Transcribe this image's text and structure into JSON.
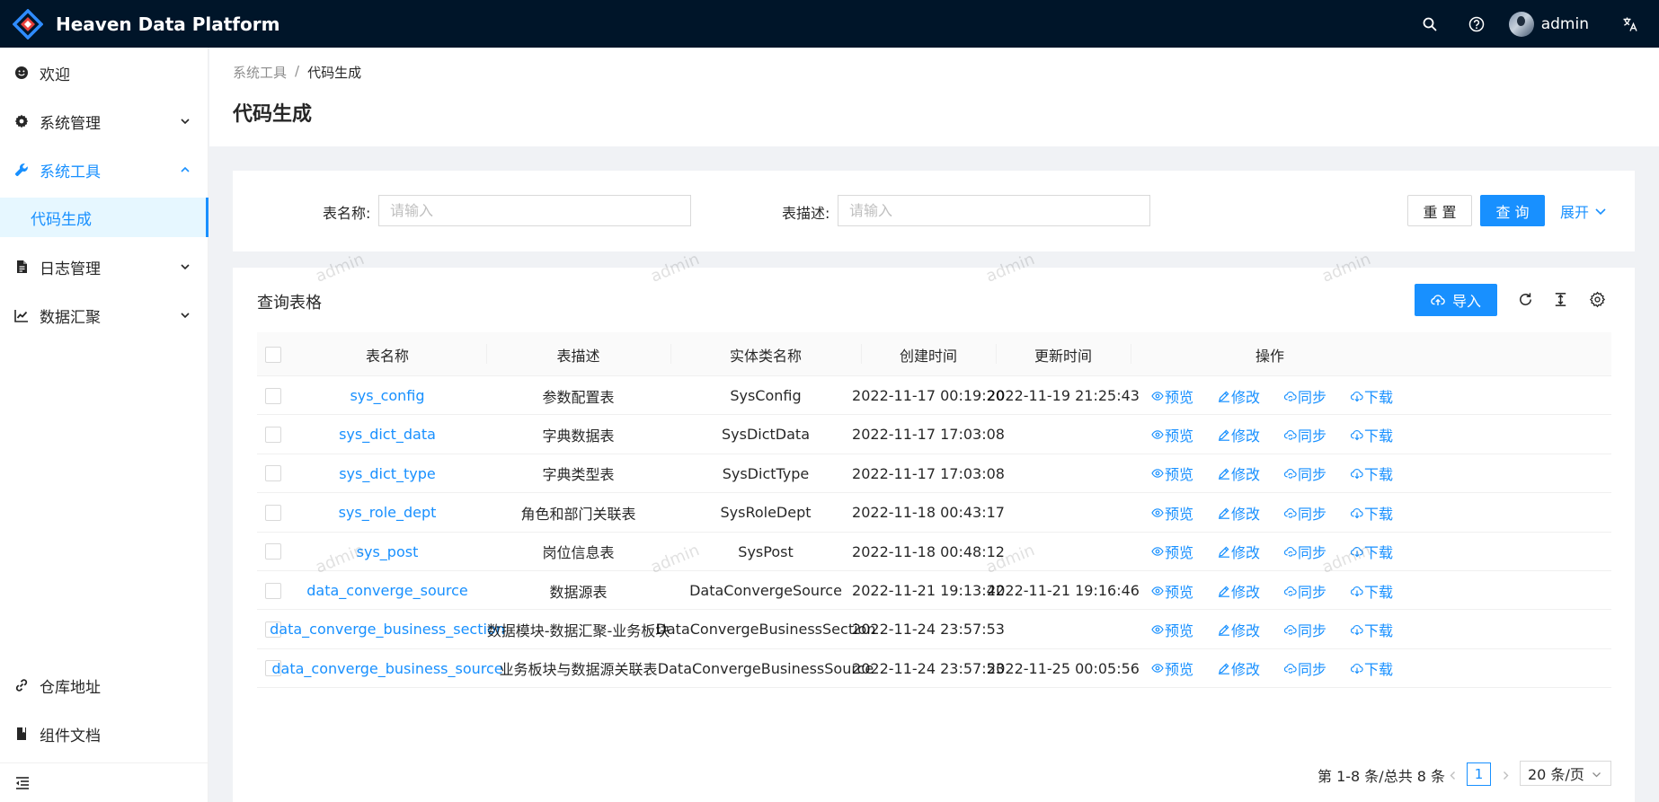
{
  "app": {
    "title": "Heaven Data Platform"
  },
  "header": {
    "user_name": "admin"
  },
  "sidebar": {
    "items": [
      {
        "label": "欢迎"
      },
      {
        "label": "系统管理"
      },
      {
        "label": "系统工具"
      },
      {
        "label": "代码生成"
      },
      {
        "label": "日志管理"
      },
      {
        "label": "数据汇聚"
      },
      {
        "label": "仓库地址"
      },
      {
        "label": "组件文档"
      }
    ]
  },
  "breadcrumb": {
    "parent": "系统工具",
    "separator": "/",
    "current": "代码生成"
  },
  "page": {
    "title": "代码生成"
  },
  "search": {
    "table_name_label": "表名称:",
    "table_name_placeholder": "请输入",
    "table_desc_label": "表描述:",
    "table_desc_placeholder": "请输入",
    "reset_label": "重 置",
    "query_label": "查 询",
    "expand_label": "展开"
  },
  "table": {
    "title": "查询表格",
    "import_label": "导入",
    "columns": [
      "表名称",
      "表描述",
      "实体类名称",
      "创建时间",
      "更新时间",
      "操作"
    ],
    "actions": [
      "预览",
      "修改",
      "同步",
      "下载"
    ],
    "rows": [
      {
        "name": "sys_config",
        "desc": "参数配置表",
        "entity": "SysConfig",
        "created": "2022-11-17 00:19:20",
        "updated": "2022-11-19 21:25:43"
      },
      {
        "name": "sys_dict_data",
        "desc": "字典数据表",
        "entity": "SysDictData",
        "created": "2022-11-17 17:03:08",
        "updated": ""
      },
      {
        "name": "sys_dict_type",
        "desc": "字典类型表",
        "entity": "SysDictType",
        "created": "2022-11-17 17:03:08",
        "updated": ""
      },
      {
        "name": "sys_role_dept",
        "desc": "角色和部门关联表",
        "entity": "SysRoleDept",
        "created": "2022-11-18 00:43:17",
        "updated": ""
      },
      {
        "name": "sys_post",
        "desc": "岗位信息表",
        "entity": "SysPost",
        "created": "2022-11-18 00:48:12",
        "updated": ""
      },
      {
        "name": "data_converge_source",
        "desc": "数据源表",
        "entity": "DataConvergeSource",
        "created": "2022-11-21 19:13:42",
        "updated": "2022-11-21 19:16:46"
      },
      {
        "name": "data_converge_business_section",
        "desc": "数据模块-数据汇聚-业务板块",
        "entity": "DataConvergeBusinessSection",
        "created": "2022-11-24 23:57:53",
        "updated": ""
      },
      {
        "name": "data_converge_business_source",
        "desc": "业务板块与数据源关联表",
        "entity": "DataConvergeBusinessSource",
        "created": "2022-11-24 23:57:53",
        "updated": "2022-11-25 00:05:56"
      }
    ]
  },
  "pagination": {
    "total_text": "第 1-8 条/总共 8 条",
    "current_page": "1",
    "page_size": "20 条/页"
  },
  "watermark": {
    "text": "admin"
  },
  "colors": {
    "header_bg": "#001529",
    "primary": "#1890ff",
    "page_bg": "#f0f2f5"
  }
}
